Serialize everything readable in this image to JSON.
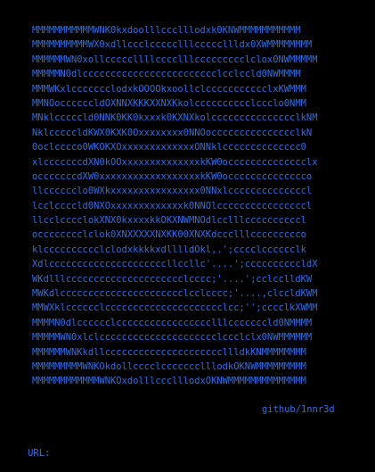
{
  "terminal": {
    "ascii_art": [
      "MMMMMMMMMMMWNK0kxdoolllccclllodxk0KNWMMMMMMMMMMM",
      "MMMMMMMMMMWX0xdllccclccccclllcccccllldx0XWMMMMMMMM",
      "MMMMMMWN0xollcccccllllcccclllccccccccclclox0NWMMMMM",
      "MMMMMN0dlcccccccccccccccccccccccclcclccld0NWMMMM",
      "MMMWKxlccccccclodxkOOOOkxoollclccccccccccclxKWMMM",
      "MMNOoccccccldOXNNXKKKXXNXKkolcccccccccclccclo0NMM",
      "MNklcccccld0NNK0KK0kxxxk0KXNXkolccccccccccccccclkNM",
      "NklcccccldKWX0KXK0Oxxxxxxxx0NNOoccccccccccccccclkN",
      "0oclcccco0WKOKXOxxxxxxxxxxxxxONNklcccccccccccccc0",
      "xlcccccccdXN0kOOxxxxxxxxxxxxxxkKW0occcccccccccccclx",
      "occcccccdXW0xxxxxxxxxxxxxxxxxxkKW0occcccccccccccco",
      "llcccccclo0WXkxxxxxxxxxxxxxxxx0NNxlccccccccccccccl",
      "lcclccccld0NXOxxxxxxxxxxxxxk0NNOlccccccccccccccccl",
      "llcclcccclokXNX0kxxxxkkOKXNWMNOdlcclllccccccccccl",
      "occcccccclclok0XNXXXXXNXKK00XNXKdccclllccccccccco",
      "klcccccccccclclodxkkkkxdlllldOkl,.';cccclcccccclk",
      "Xdlcccccccccccccccccccccllccllc'....';ccccccccccldX",
      "WKdlllccccccccccccccccccccclcccc;'....';cclcclldKW",
      "MWKdlcccccccccccccccccccccclcclcccc;'....,clccldKWM",
      "MMWXklcccccclccccccccccccccccccccclcc;'';cccclkXWMM",
      "MMMMN0dlcccccclccccccccccccccccclllcccccccld0NMMMM",
      "MMMMMWN0xlclccccccccccccccccccccclccclclx0NWMMMMMM",
      "MMMMMMWNKkdllcccccccccccccccccccccllldkKNMMMMMMMM",
      "MMMMMMMMMWNKOkdollcccclccccccclllodkOKNWMMMMMMMMM",
      "MMMMMMMMMMMMWNKOxdolllccclllodxOKNWMMMMMMMMMMMMMM"
    ],
    "credit": "github/1nnr3d",
    "prompt_label": "URL:",
    "prompt_value": "",
    "color": "#2f6fe8",
    "background": "#000000"
  }
}
